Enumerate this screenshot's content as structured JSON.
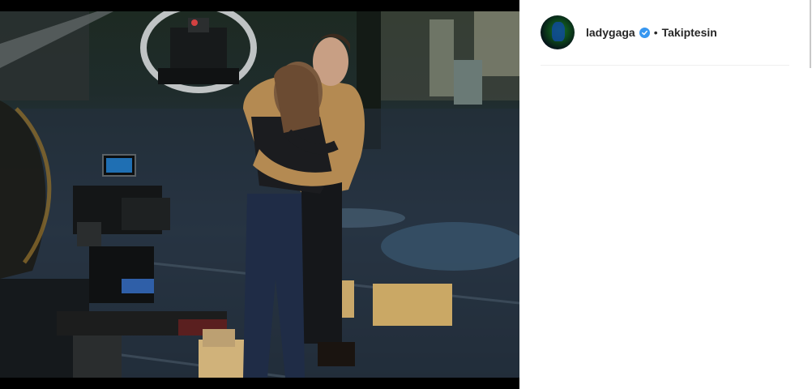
{
  "post": {
    "image_alt_icon": "photo",
    "author": {
      "username": "ladygaga",
      "verified": true,
      "separator": "•",
      "follow_status": "Takiptesin"
    }
  },
  "colors": {
    "verified_badge": "#3897f0",
    "text": "#262626",
    "divider": "#efefef"
  }
}
